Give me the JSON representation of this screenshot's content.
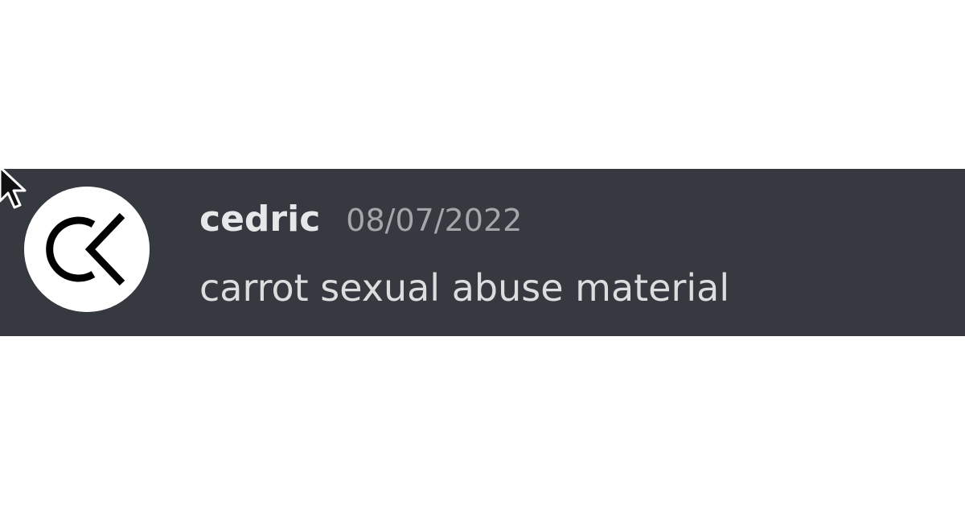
{
  "message": {
    "author": {
      "username": "cedric",
      "avatar_icon": "ck-logo-icon"
    },
    "timestamp": "08/07/2022",
    "content": "carrot sexual abuse material"
  },
  "colors": {
    "message_background": "#36393f",
    "username": "#e6e7e9",
    "timestamp": "#a3a6aa",
    "content": "#dcddde",
    "page_background": "#ffffff"
  },
  "cursor_icon": "mouse-pointer-icon"
}
